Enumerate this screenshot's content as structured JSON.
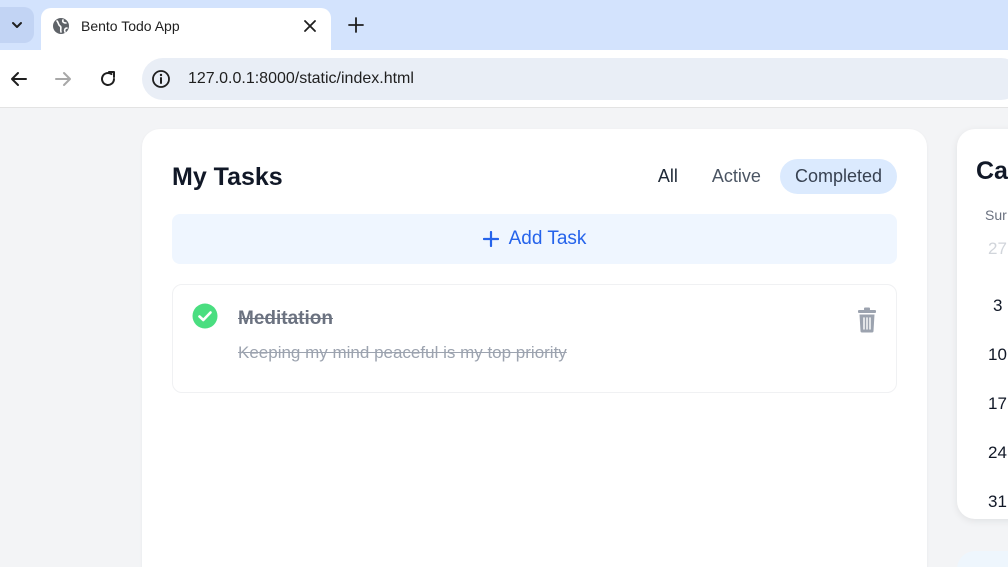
{
  "browser": {
    "tab_title": "Bento Todo App",
    "url": "127.0.0.1:8000/static/index.html",
    "icons": [
      "chevron-down-icon",
      "globe-icon",
      "close-icon",
      "plus-icon",
      "back-arrow-icon",
      "forward-arrow-icon",
      "reload-icon",
      "info-icon"
    ]
  },
  "tasks": {
    "title": "My Tasks",
    "filters": [
      "All",
      "Active",
      "Completed"
    ],
    "selected_filter": "Completed",
    "add_task_label": "Add Task",
    "items": [
      {
        "title": "Meditation",
        "description": "Keeping my mind peaceful is my top priority",
        "completed": true
      }
    ]
  },
  "calendar": {
    "title": "Cal",
    "day_of_week": "Sur",
    "days": [
      "27",
      "3",
      "10",
      "17",
      "24",
      "31"
    ]
  },
  "colors": {
    "accent": "#2563eb",
    "accent_soft": "#eff6ff",
    "selected_filter_bg": "#dbeafe",
    "complete_green": "#4ade80"
  }
}
